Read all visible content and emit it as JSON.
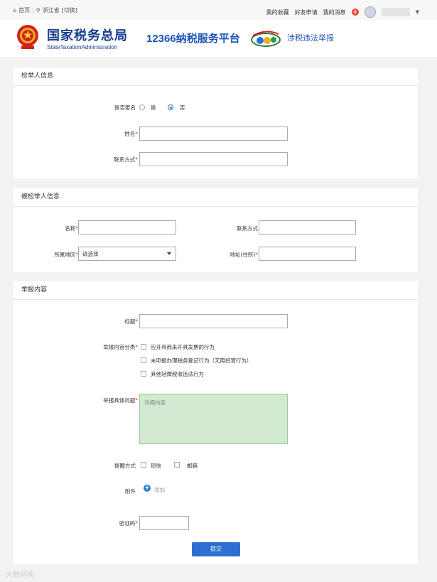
{
  "topbar": {
    "home": "首页",
    "region": "浙江省",
    "switch": "[切换]",
    "links": [
      "我的收藏",
      "好友申请",
      "我的消息"
    ],
    "message_count": "4"
  },
  "header": {
    "title": "国家税务总局",
    "subtitle_en": "StateTaxationAdministration",
    "platform": "12366纳税服务平台",
    "page_subtitle": "涉税违法举报"
  },
  "reporter": {
    "section_title": "检举人信息",
    "anonymous_label": "是否匿名",
    "opt_yes": "是",
    "opt_no": "否",
    "name_label": "姓名",
    "contact_label": "联系方式"
  },
  "reported": {
    "section_title": "被检举人信息",
    "name_label": "名称",
    "contact_label": "联系方式",
    "region_label": "所属地区",
    "region_select": "请选择",
    "address_label": "地址(住所)"
  },
  "content": {
    "section_title": "举报内容",
    "title_label": "标题",
    "category_label": "举报内容分类",
    "categories": [
      "应开具而未开具发票的行为",
      "未申报办理税务登记行为（无照经营行为）",
      "其他轻微税收违法行为"
    ],
    "issue_label": "举报具体问题",
    "issue_placeholder": "详细内容",
    "notify_label": "提醒方式",
    "notify_sms": "短信",
    "notify_email": "邮箱",
    "attach_label": "附件",
    "attach_add": "添加",
    "captcha_label": "验证码",
    "submit": "提交"
  },
  "watermark": "大数网视"
}
